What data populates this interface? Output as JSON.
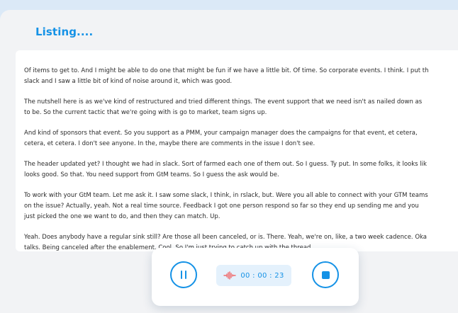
{
  "page": {
    "title": "Listing...."
  },
  "transcript": [
    {
      "line1": "Of items to get to. And I might be able to do one that might be fun if we have a little bit. Of time. So corporate events. I think. I put th",
      "line2": "slack and I saw a little bit of kind of noise around it, which was good."
    },
    {
      "line1": "The nutshell here is as we've kind of restructured and tried different things. The event support that we need isn't as nailed down as",
      "line2": "to be. So the current tactic that we're going with is go to market, team signs up."
    },
    {
      "line1": "And kind of sponsors that event. So you support as a PMM, your campaign manager does the campaigns for that event, et cetera,",
      "line2": "cetera, et cetera. I don't see anyone. In the, maybe there are comments in the issue I don't see."
    },
    {
      "line1": "The header updated yet? I thought we had in slack. Sort of farmed each one of them out. So I guess. Ty put. In some folks, it looks lik",
      "line2": "looks good. So that. You need support from GtM teams. So I guess the ask would be."
    },
    {
      "line1": "To work with your GtM team. Let me ask it. I saw some slack, I think, in rslack, but. Were you all able to connect with your GTM teams",
      "line2": "on the issue? Actually, yeah. Not a real time source. Feedback I got one person respond so far so they end up sending me and you",
      "line3": "just picked the one we want to do, and then they can match. Up."
    },
    {
      "line1": "Yeah. Does anybody have a regular sink still? Are those all been canceled, or is. There. Yeah, we're on, like, a two week cadence. Oka",
      "line2": "talks. Being canceled after the enablement. Cool. So I'm just trying to catch up with the thread."
    }
  ],
  "recorder": {
    "timer": "00 : 00 : 23",
    "pause_icon": "pause-icon",
    "stop_icon": "stop-icon",
    "wave_icon": "audio-wave-icon"
  },
  "colors": {
    "accent": "#1592e6",
    "wave": "#f06a6a",
    "timer_bg": "#e4f1fc",
    "background": "#f2f3f5"
  }
}
